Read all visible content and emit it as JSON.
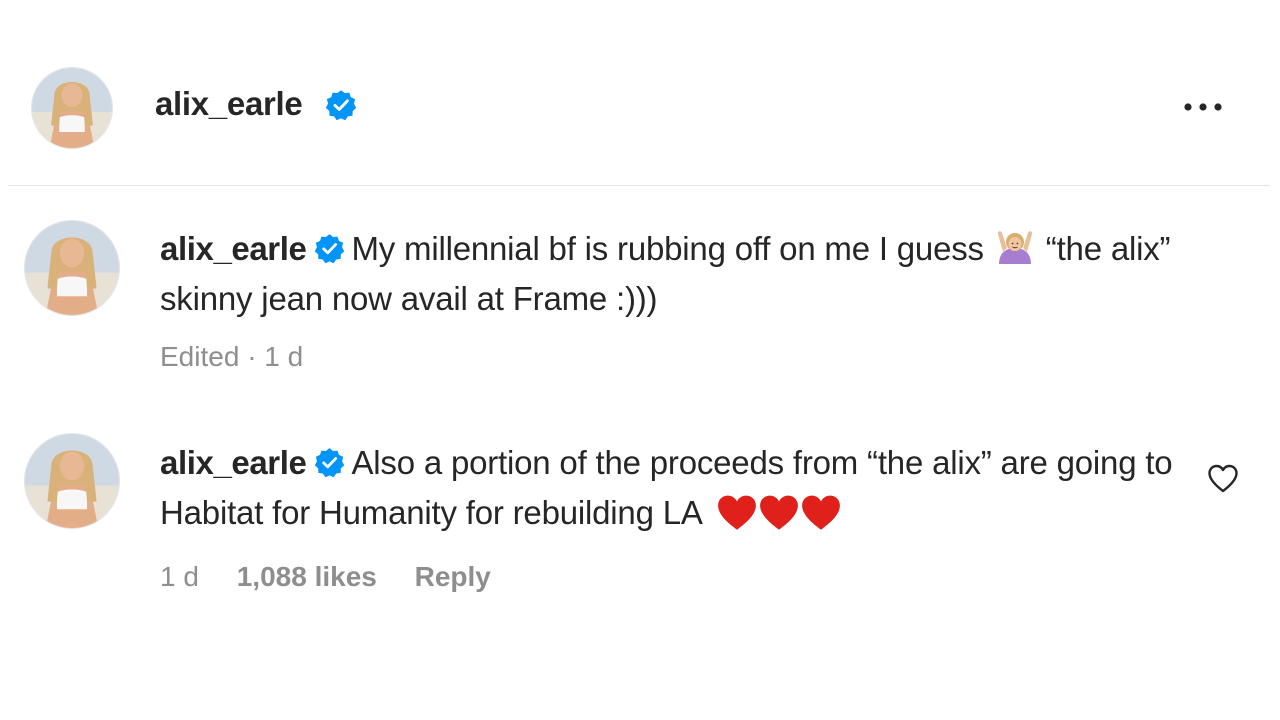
{
  "post_header": {
    "username": "alix_earle",
    "verified": true,
    "more_icon": "more-horizontal-icon"
  },
  "comments": [
    {
      "username": "alix_earle",
      "verified": true,
      "text": "My millennial bf is rubbing off on me I guess",
      "emoji": "person-gesturing-ok-emoji",
      "text_after": "“the alix” skinny jean now avail at Frame :)))",
      "meta": {
        "edited": "Edited",
        "separator": "·",
        "time": "1 d"
      }
    },
    {
      "username": "alix_earle",
      "verified": true,
      "text": "Also a portion of the proceeds from “the alix” are going to Habitat for Humanity for rebuilding LA",
      "emoji": "red-heart-emoji x3",
      "meta": {
        "time": "1 d",
        "likes": "1,088 likes",
        "reply": "Reply"
      },
      "like_icon": "heart-outline-icon"
    }
  ],
  "colors": {
    "text": "#262626",
    "muted": "#8e8e8e",
    "verified_blue": "#0095f6",
    "heart_red": "#e0201b",
    "divider": "#e4e4e4"
  }
}
